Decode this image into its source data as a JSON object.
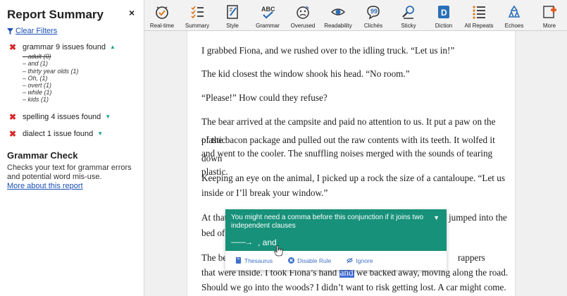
{
  "sidebar": {
    "title": "Report Summary",
    "close_label": "×",
    "clear_filters": "Clear Filters",
    "issues": [
      {
        "label": "grammar 9 issues found",
        "expanded": true,
        "items": [
          "adult (0)",
          "and (1)",
          "thirty year olds (1)",
          "Oh, (1)",
          "overt (1)",
          "while (1)",
          "kids (1)"
        ]
      },
      {
        "label": "spelling 4 issues found",
        "expanded": false
      },
      {
        "label": "dialect 1 issue found",
        "expanded": false
      }
    ],
    "grammar_check": {
      "title": "Grammar Check",
      "description": "Checks your text for grammar errors and potential word mis-use.",
      "link": "More about this report"
    }
  },
  "toolbar": {
    "items": [
      {
        "label": "Real-time",
        "icon": "realtime-icon"
      },
      {
        "label": "Summary",
        "icon": "summary-icon"
      },
      {
        "label": "Style",
        "icon": "style-icon"
      },
      {
        "label": "Grammar",
        "icon": "grammar-icon"
      },
      {
        "label": "Overused",
        "icon": "overused-icon"
      },
      {
        "label": "Readability",
        "icon": "readability-icon"
      },
      {
        "label": "Clichés",
        "icon": "cliches-icon"
      },
      {
        "label": "Sticky",
        "icon": "sticky-icon"
      },
      {
        "label": "Diction",
        "icon": "diction-icon"
      },
      {
        "label": "All Repeats",
        "icon": "all-repeats-icon"
      },
      {
        "label": "Echoes",
        "icon": "echoes-icon"
      },
      {
        "label": "More",
        "icon": "more-icon"
      }
    ]
  },
  "document": {
    "p1": "I grabbed Fiona, and we rushed over to the idling truck. “Let us in!”",
    "p2": "The kid closest the window shook his head. “No room.”",
    "p3": "“Please!” How could they refuse?",
    "p4_l1": "The bear arrived at the campsite and paid no attention to us. It put a paw on the plastic",
    "p4_l2": "of the bacon package and pulled out the raw contents with its teeth. It wolfed it down",
    "p4_l3": "and went to the cooler. The snuffling noises merged with the sounds of tearing plastic.",
    "p5_l1": "Keeping an eye on the animal, I picked up a rock the size of a cantaloupe. “Let us",
    "p5_l2": "inside or I’ll break your window.”",
    "p6_l1_start": "At that",
    "p6_l1_end": "jumped into the",
    "p6_l2_start": "bed of",
    "p7_l1_start": "The be",
    "p7_l1_end": "rappers",
    "p7_l2_a": "that were inside. I took Fiona’s hand",
    "p7_l2_hl": "and",
    "p7_l2_b": "we backed away, moving along the road.",
    "p7_l3": "Should we go into the woods? I didn’t want to risk getting lost. A car might come."
  },
  "popup": {
    "message": "You might need a comma before this conjunction if it joins two independent clauses",
    "suggestion": ", and",
    "thesaurus": "Thesaurus",
    "disable_rule": "Disable Rule",
    "ignore": "Ignore"
  },
  "colors": {
    "accent": "#17917a",
    "error": "#d62a2a",
    "link": "#1a4fb5",
    "highlight": "#3d6bd6"
  }
}
